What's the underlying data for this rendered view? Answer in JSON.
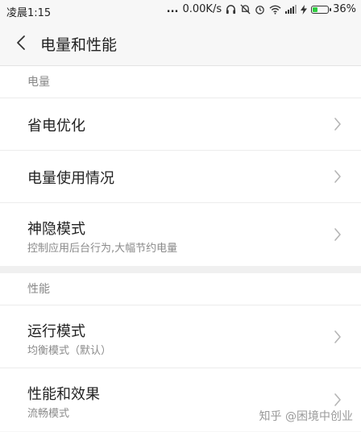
{
  "status_bar": {
    "time": "凌晨1:15",
    "dots": "...",
    "speed": "0.00K/s",
    "battery": "36%",
    "battery_level": 0.36,
    "battery_fill_color": "#2ecc40"
  },
  "header": {
    "title": "电量和性能",
    "back_icon": "chevron-left-icon"
  },
  "sections": [
    {
      "header": "电量",
      "items": [
        {
          "title": "省电优化",
          "subtitle": ""
        },
        {
          "title": "电量使用情况",
          "subtitle": ""
        },
        {
          "title": "神隐模式",
          "subtitle": "控制应用后台行为,大幅节约电量"
        }
      ]
    },
    {
      "header": "性能",
      "items": [
        {
          "title": "运行模式",
          "subtitle": "均衡模式（默认）"
        },
        {
          "title": "性能和效果",
          "subtitle": "流畅模式"
        }
      ]
    }
  ],
  "watermark": "知乎 @困境中创业"
}
